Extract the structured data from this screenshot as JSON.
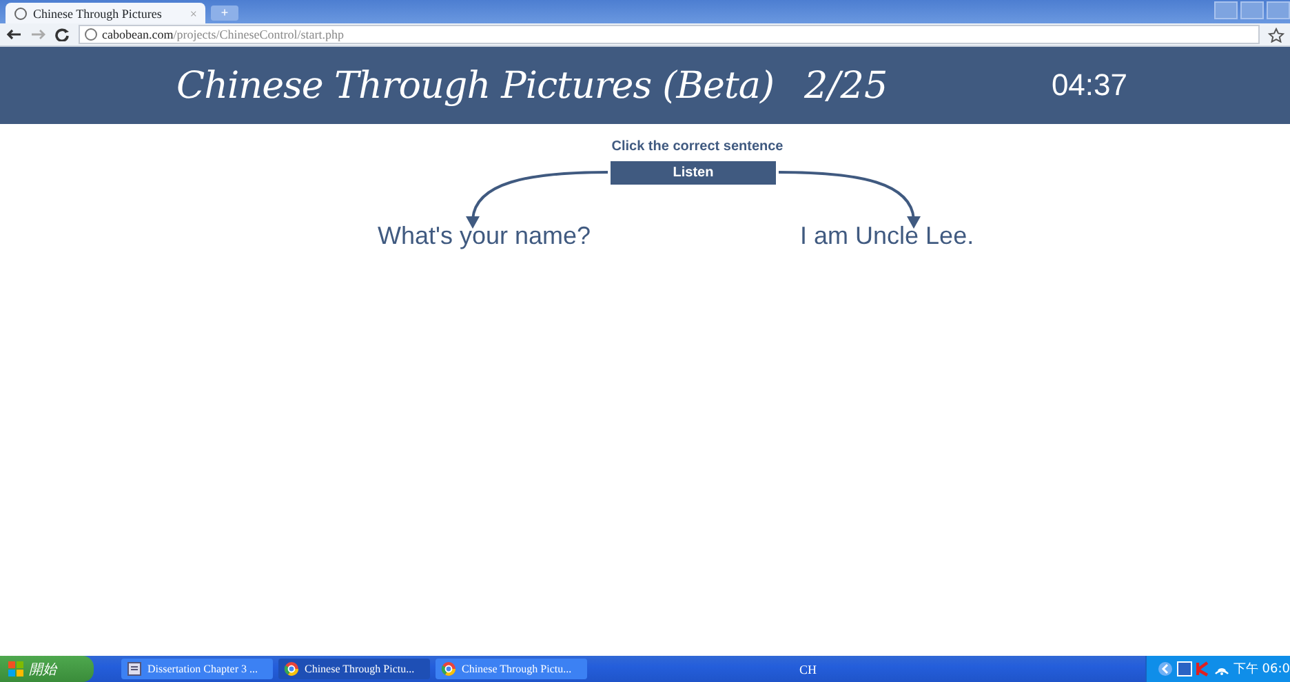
{
  "browser": {
    "tab_title": "Chinese Through Pictures",
    "tab_close": "×",
    "new_tab": "+",
    "address_domain": "cabobean.com",
    "address_path": "/projects/ChineseControl/start.php"
  },
  "header": {
    "title": "Chinese Through Pictures (Beta)",
    "progress": "2/25",
    "timer": "04:37"
  },
  "quiz": {
    "instruction": "Click the correct sentence",
    "listen_button": "Listen",
    "choices": [
      {
        "text": "What's your name?"
      },
      {
        "text": "I am Uncle Lee."
      }
    ]
  },
  "taskbar": {
    "start": "開始",
    "items": [
      {
        "label": "Dissertation Chapter 3 ...",
        "kind": "document",
        "selected": false
      },
      {
        "label": "Chinese Through Pictu...",
        "kind": "browser",
        "selected": true
      },
      {
        "label": "Chinese Through Pictu...",
        "kind": "browser",
        "selected": false
      }
    ],
    "language": "CH",
    "clock": "下午 06:0"
  }
}
